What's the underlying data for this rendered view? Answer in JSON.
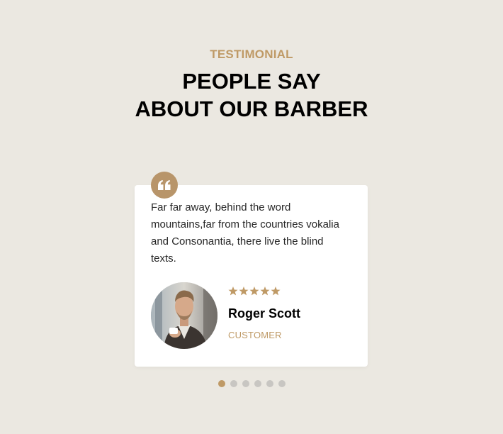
{
  "section": {
    "eyebrow": "TESTIMONIAL",
    "heading_line1": "PEOPLE SAY",
    "heading_line2": "ABOUT OUR BARBER"
  },
  "testimonial": {
    "quote_icon": "quote-left-icon",
    "text": "Far far away, behind the word mountains,far from the countries vokalia and Consonantia, there live the blind texts.",
    "rating": 5,
    "author_name": "Roger Scott",
    "author_role": "CUSTOMER",
    "avatar": "customer-photo"
  },
  "carousel": {
    "slide_count": 6,
    "active_index": 0
  },
  "colors": {
    "background": "#ebe8e1",
    "accent": "#bf9a66",
    "card": "#ffffff",
    "dot_inactive": "#c8c6c2"
  }
}
